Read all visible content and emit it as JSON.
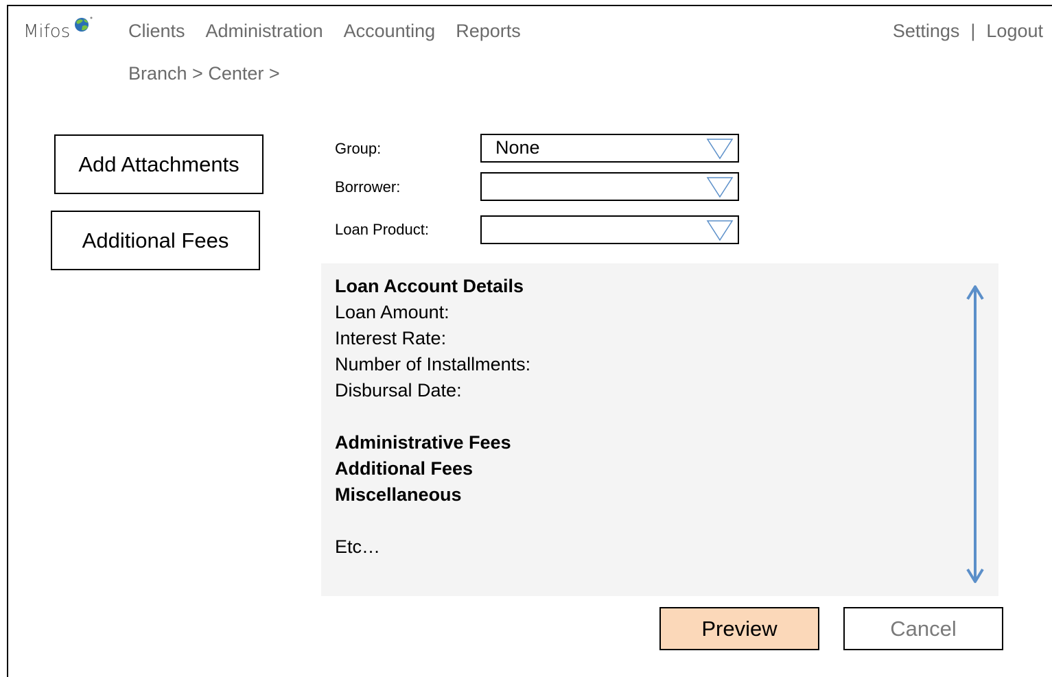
{
  "app": {
    "logo_text": "Mifos"
  },
  "nav": {
    "items": [
      "Clients",
      "Administration",
      "Accounting",
      "Reports"
    ],
    "settings": "Settings",
    "separator": "|",
    "logout": "Logout"
  },
  "breadcrumb": "Branch > Center >",
  "sidebar": {
    "add_attachments": "Add Attachments",
    "additional_fees": "Additional Fees"
  },
  "form": {
    "group_label": "Group:",
    "group_value": "None",
    "borrower_label": "Borrower:",
    "borrower_value": "",
    "loan_product_label": "Loan Product:",
    "loan_product_value": ""
  },
  "details": {
    "heading": "Loan Account Details",
    "loan_amount": "Loan Amount:",
    "interest_rate": "Interest Rate:",
    "installments": "Number of Installments:",
    "disbursal_date": "Disbursal Date:",
    "admin_fees": "Administrative Fees",
    "additional_fees": "Additional Fees",
    "misc": "Miscellaneous",
    "etc": "Etc…"
  },
  "actions": {
    "preview": "Preview",
    "cancel": "Cancel"
  },
  "colors": {
    "preview_bg": "#fbd8b9",
    "scroll_arrow": "#5b8fc9",
    "dropdown_arrow": "#5b8fc9",
    "panel_bg": "#f4f4f4"
  }
}
